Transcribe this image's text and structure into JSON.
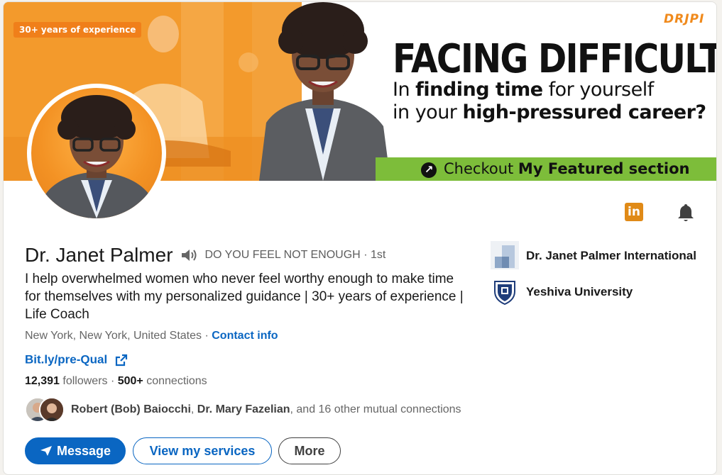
{
  "banner": {
    "experience_badge": "30+ years of experience",
    "logo_text": "DRJPI",
    "headline": "FACING DIFFICULTY",
    "subline1_pre": "In ",
    "subline1_bold": "finding time",
    "subline1_post": " for yourself",
    "subline2_pre": "in your ",
    "subline2_bold": "high-pressured career?",
    "cta_pre": "Checkout ",
    "cta_bold": "My Featured section",
    "colors": {
      "orange": "#f29a2a",
      "green": "#7dbd3a"
    }
  },
  "profile": {
    "name": "Dr. Janet Palmer",
    "pronunciation_icon": "speaker-icon",
    "pronoun_text": "DO YOU FEEL NOT ENOUGH",
    "degree": "· 1st",
    "headline": "I help overwhelmed women who never feel worthy enough to make time for themselves with my personalized guidance | 30+ years of experience | Life Coach",
    "location": "New York, New York, United States",
    "separator": " · ",
    "contact_info": "Contact info",
    "website": "Bit.ly/pre-Qual",
    "followers_count": "12,391",
    "followers_label": " followers",
    "connections_sep": "  · ",
    "connections_count": "500+",
    "connections_label": " connections",
    "mutual_name1": "Robert (Bob) Baiocchi",
    "mutual_sep": ", ",
    "mutual_name2": "Dr. Mary Fazelian",
    "mutual_suffix": ", and 16 other mutual connections"
  },
  "icons": {
    "linkedin": "in",
    "bell": "bell-icon"
  },
  "buttons": {
    "message": "Message",
    "services": "View my services",
    "more": "More"
  },
  "orgs": [
    {
      "name": "Dr. Janet Palmer International",
      "logo": "company-logo"
    },
    {
      "name": "Yeshiva University",
      "logo": "university-shield"
    }
  ],
  "theme": {
    "link": "#0a66c2",
    "primary": "#0a66c2"
  }
}
